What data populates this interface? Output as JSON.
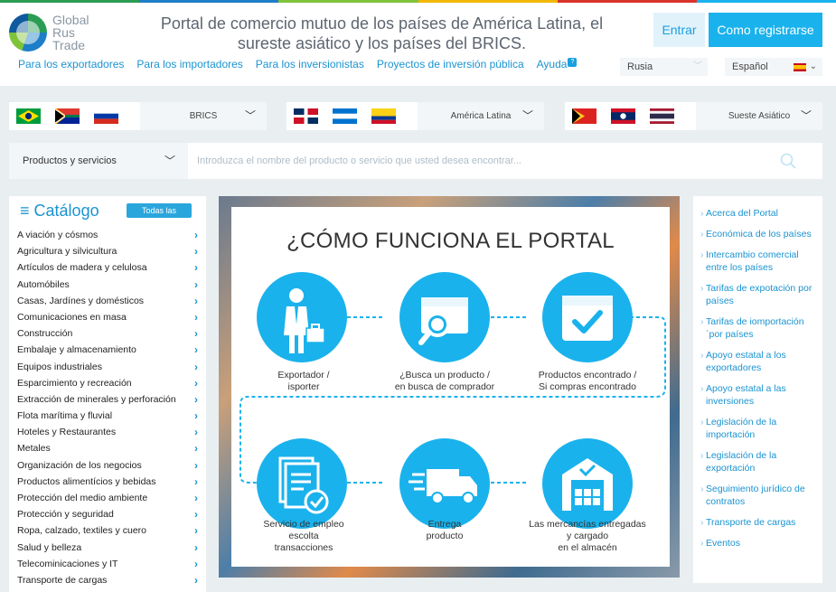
{
  "brand": {
    "logo_line1": "Global",
    "logo_line2": "Rus",
    "logo_line3": "Trade"
  },
  "header": {
    "tagline": "Portal de comercio mutuo de los países de América Latina, el sureste asiático y los países del BRICS.",
    "login_label": "Entrar",
    "register_label": "Como registrarse"
  },
  "nav": {
    "items": [
      "Para los exportadores",
      "Para los importadores",
      "Para los inversionistas",
      "Proyectos de inversión pública",
      "Ayuda"
    ],
    "help_badge": "?"
  },
  "country_select": {
    "value": "Rusia"
  },
  "language_select": {
    "value": "Español"
  },
  "regions": [
    {
      "label": "BRICS",
      "flags": [
        "brazil-flag",
        "south-africa-flag",
        "russia-flag"
      ]
    },
    {
      "label": "América Latina",
      "flags": [
        "dominican-republic-flag",
        "honduras-flag",
        "colombia-flag"
      ]
    },
    {
      "label": "Sueste Asiático",
      "flags": [
        "east-timor-flag",
        "laos-flag",
        "thailand-flag"
      ]
    }
  ],
  "search": {
    "category": "Productos y servicios",
    "placeholder": "Introduzca el nombre del producto o servicio que usted desea encontrar..."
  },
  "catalog": {
    "title": "Catálogo",
    "all_label": "Todas las",
    "items": [
      "A viación y cósmos",
      "Agricultura y silvicultura",
      "Artículos de madera y celulosa",
      "Automóbiles",
      "Casas, Jardínes y domésticos",
      "Comunicaciones en masa",
      "Construcción",
      "Embalaje y almacenamiento",
      "Equipos industriales",
      "Esparcimiento y recreación",
      "Extracción de minerales y perforación",
      "Flota marítima y fluvial",
      "Hoteles y Restaurantes",
      "Metales",
      "Organización de los negocios",
      "Productos alimentícios y bebidas",
      "Protección del medio ambiente",
      "Protección y seguridad",
      "Ropa, calzado, textiles y cuero",
      "Salud y belleza",
      "Telecominicaciones y IT",
      "Transporte de cargas"
    ]
  },
  "banner": {
    "title": "¿CÓMO FUNCIONA EL PORTAL",
    "steps": [
      {
        "icon": "exporter-person-icon",
        "label": "Exportador /\nisporter"
      },
      {
        "icon": "search-box-icon",
        "label": "¿Busca un producto /\nen busca de comprador"
      },
      {
        "icon": "checked-box-icon",
        "label": "Productos encontrado /\nSi compras encontrado"
      },
      {
        "icon": "contract-document-icon",
        "label": "Servicio de empleo\nescolta\ntransacciones"
      },
      {
        "icon": "delivery-truck-icon",
        "label": "Entrega\nproducto"
      },
      {
        "icon": "warehouse-icon",
        "label": "Las mercancías entregadas\ny cargado\nen el almacén"
      }
    ]
  },
  "sidebar_links": [
    "Acerca del Portal",
    "Económica de los países",
    "Intercambio comercial entre los países",
    "Tarifas de expotación por países",
    "Tarifas de iomportación `por países",
    "Apoyo estatal a los exportadores",
    "Apoyo estatal a las inversiones",
    "Legislación de la importación",
    "Legislación de la exportación",
    "Seguimiento jurídico de contratos",
    "Transporte de cargas",
    "Eventos"
  ],
  "colors": {
    "accent": "#1ab2ec",
    "link": "#1a93d1",
    "background": "#e9eef1"
  }
}
